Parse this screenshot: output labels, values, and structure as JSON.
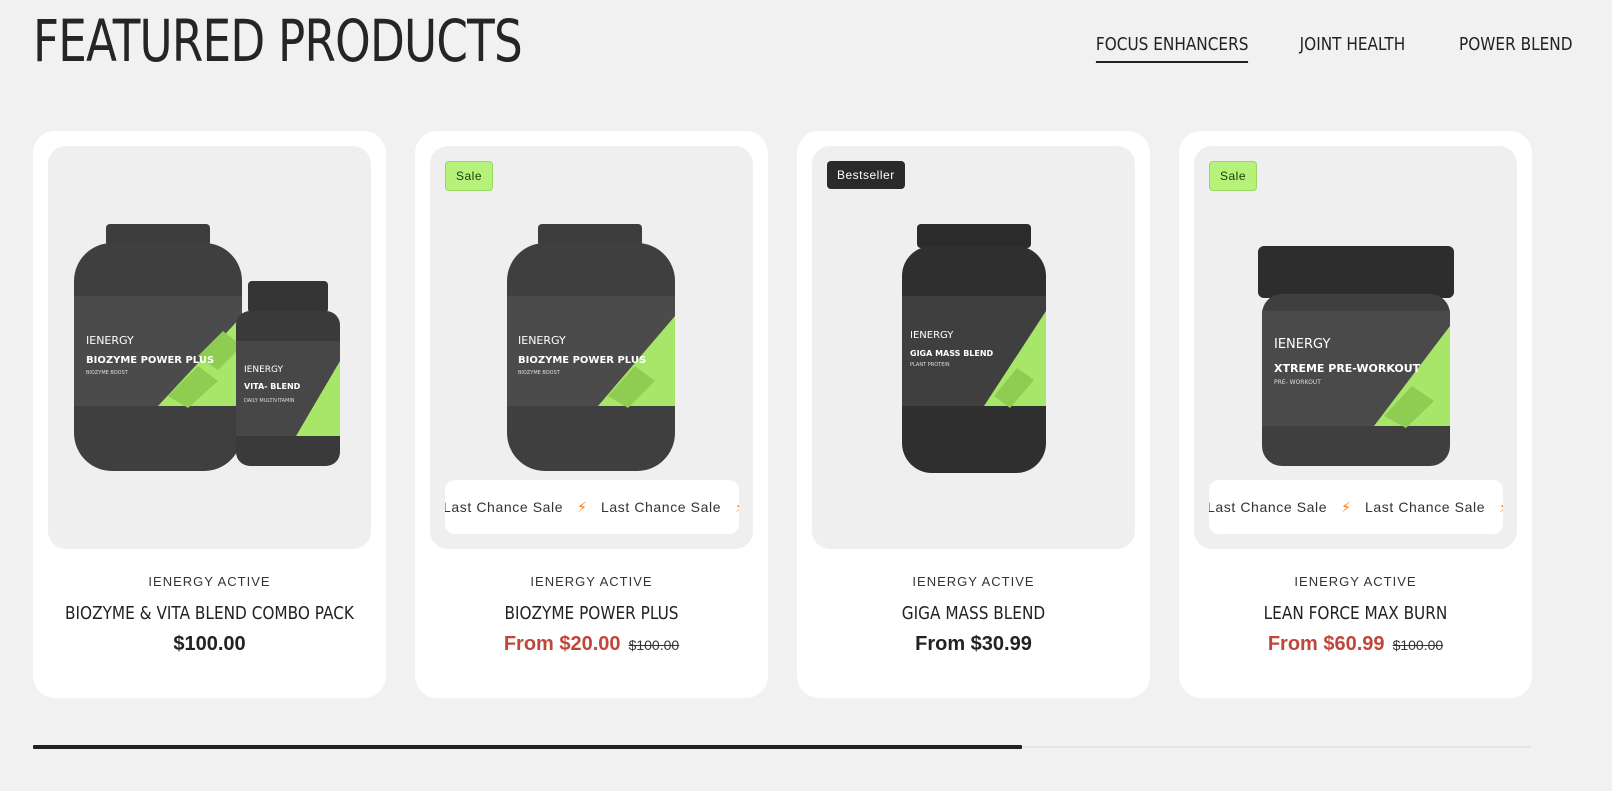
{
  "section": {
    "title": "FEATURED PRODUCTS",
    "tabs": [
      {
        "label": "FOCUS ENHANCERS",
        "active": true
      },
      {
        "label": "JOINT HEALTH",
        "active": false
      },
      {
        "label": "POWER BLEND",
        "active": false
      }
    ]
  },
  "products": [
    {
      "brand": "IENERGY ACTIVE",
      "name": "BIOZYME & VITA BLEND COMBO PACK",
      "price": "$100.00",
      "compare_price": "",
      "badge": "",
      "marquee": "",
      "label_main": "BIOZYME POWER PLUS",
      "label_sub": "BIOZYME BOOST",
      "label_small": "VITA- BLEND",
      "label_small_sub": "DAILY MULTIVITAMIN",
      "logo": "IENERGY"
    },
    {
      "brand": "IENERGY ACTIVE",
      "name": "BIOZYME POWER PLUS",
      "price": "From $20.00",
      "compare_price": "$100.00",
      "badge": "Sale",
      "marquee": "Last Chance Sale",
      "label_main": "BIOZYME POWER PLUS",
      "label_sub": "BIOZYME BOOST",
      "logo": "IENERGY"
    },
    {
      "brand": "IENERGY ACTIVE",
      "name": "GIGA MASS BLEND",
      "price": "From $30.99",
      "compare_price": "",
      "badge": "Bestseller",
      "marquee": "",
      "label_main": "GIGA MASS BLEND",
      "label_sub": "PLANT PROTEIN",
      "logo": "IENERGY"
    },
    {
      "brand": "IENERGY ACTIVE",
      "name": "LEAN FORCE MAX BURN",
      "price": "From $60.99",
      "compare_price": "$100.00",
      "badge": "Sale",
      "marquee": "Last Chance Sale",
      "label_main": "XTREME PRE-WORKOUT",
      "label_sub": "PRE- WORKOUT",
      "logo": "IENERGY"
    }
  ],
  "icons": {
    "marquee_separator": "lightning-bolt-icon"
  },
  "colors": {
    "sale_price": "#c0463c",
    "sale_badge": "#b6f27a",
    "bestseller_badge": "#2a2a2a",
    "accent_bolt": "#f27b1b",
    "label_green": "#a8e66a"
  },
  "scrollbar": {
    "progress": 0.66
  }
}
